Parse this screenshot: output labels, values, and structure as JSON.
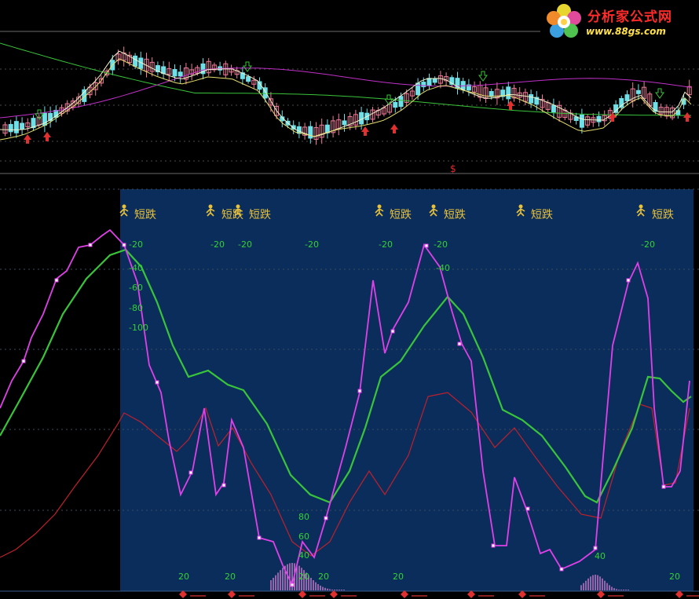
{
  "watermark": {
    "title": "分析家公式网",
    "url": "www.88gs.com"
  },
  "top_panel": {
    "marker": "$"
  },
  "signals": {
    "label": "短跌"
  },
  "indicator": {
    "upper_levels": [
      "-20",
      "-40",
      "-60",
      "-80",
      "-100"
    ],
    "upper_repeats": [
      "-20",
      "-20",
      "-20",
      "-20",
      "-20",
      "-40",
      "-20"
    ],
    "lower_levels": [
      "80",
      "60",
      "40",
      "20"
    ],
    "bottom_labels": [
      "20",
      "20",
      "20",
      "40",
      "20"
    ]
  },
  "colors": {
    "panel_bg": "#0b2d5c",
    "grid": "#5a6a7a",
    "magenta": "#e040e8",
    "green": "#39c43a",
    "red": "#c0202c",
    "level_text": "#33d133",
    "signal_text": "#e8c13a",
    "candle_up": "#f07a9a",
    "candle_down": "#6fe0e8"
  }
}
